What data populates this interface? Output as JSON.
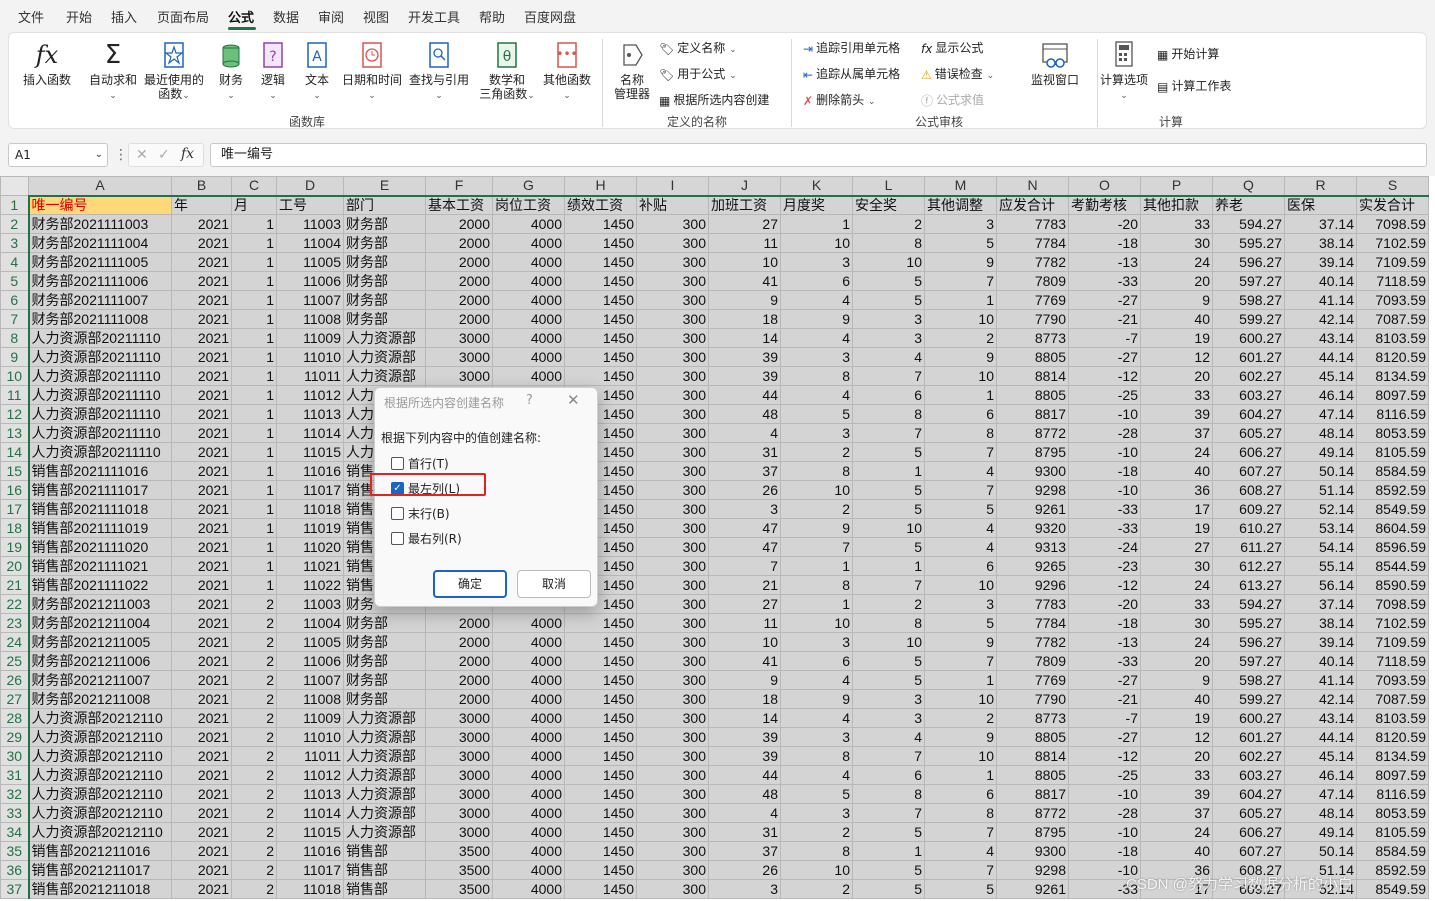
{
  "menu": [
    "文件",
    "开始",
    "插入",
    "页面布局",
    "公式",
    "数据",
    "审阅",
    "视图",
    "开发工具",
    "帮助",
    "百度网盘"
  ],
  "active_tab": "公式",
  "ribbon": {
    "insert_function": "插入函数",
    "autosum": "自动求和",
    "recent_1": "最近使用的",
    "recent_2": "函数",
    "financial": "财务",
    "logical": "逻辑",
    "text": "文本",
    "datetime": "日期和时间",
    "lookup": "查找与引用",
    "math_1": "数学和",
    "math_2": "三角函数",
    "more": "其他函数",
    "group_library": "函数库",
    "name_mgr_1": "名称",
    "name_mgr_2": "管理器",
    "define_name": "定义名称",
    "use_in_formula": "用于公式",
    "create_from_sel": "根据所选内容创建",
    "group_names": "定义的名称",
    "trace_precedents": "追踪引用单元格",
    "trace_dependents": "追踪从属单元格",
    "remove_arrows": "删除箭头",
    "show_formulas": "显示公式",
    "error_check": "错误检查",
    "evaluate": "公式求值",
    "watch": "监视窗口",
    "group_audit": "公式审核",
    "calc_options": "计算选项",
    "calc_now": "开始计算",
    "calc_sheet": "计算工作表",
    "group_calc": "计算"
  },
  "formula_bar": {
    "name_box": "A1",
    "fx": "fx",
    "content": "唯一编号"
  },
  "columns": [
    "A",
    "B",
    "C",
    "D",
    "E",
    "F",
    "G",
    "H",
    "I",
    "J",
    "K",
    "L",
    "M",
    "N",
    "O",
    "P",
    "Q",
    "R",
    "S"
  ],
  "header_row": [
    "唯一编号",
    "年",
    "月",
    "工号",
    "部门",
    "基本工资",
    "岗位工资",
    "绩效工资",
    "补贴",
    "加班工资",
    "月度奖",
    "安全奖",
    "其他调整",
    "应发合计",
    "考勤考核",
    "其他扣款",
    "养老",
    "医保",
    "实发合计"
  ],
  "rows": [
    [
      "财务部2021111003",
      "2021",
      "1",
      "11003",
      "财务部",
      "2000",
      "4000",
      "1450",
      "300",
      "27",
      "1",
      "2",
      "3",
      "7783",
      "-20",
      "33",
      "594.27",
      "37.14",
      "7098.59"
    ],
    [
      "财务部2021111004",
      "2021",
      "1",
      "11004",
      "财务部",
      "2000",
      "4000",
      "1450",
      "300",
      "11",
      "10",
      "8",
      "5",
      "7784",
      "-18",
      "30",
      "595.27",
      "38.14",
      "7102.59"
    ],
    [
      "财务部2021111005",
      "2021",
      "1",
      "11005",
      "财务部",
      "2000",
      "4000",
      "1450",
      "300",
      "10",
      "3",
      "10",
      "9",
      "7782",
      "-13",
      "24",
      "596.27",
      "39.14",
      "7109.59"
    ],
    [
      "财务部2021111006",
      "2021",
      "1",
      "11006",
      "财务部",
      "2000",
      "4000",
      "1450",
      "300",
      "41",
      "6",
      "5",
      "7",
      "7809",
      "-33",
      "20",
      "597.27",
      "40.14",
      "7118.59"
    ],
    [
      "财务部2021111007",
      "2021",
      "1",
      "11007",
      "财务部",
      "2000",
      "4000",
      "1450",
      "300",
      "9",
      "4",
      "5",
      "1",
      "7769",
      "-27",
      "9",
      "598.27",
      "41.14",
      "7093.59"
    ],
    [
      "财务部2021111008",
      "2021",
      "1",
      "11008",
      "财务部",
      "2000",
      "4000",
      "1450",
      "300",
      "18",
      "9",
      "3",
      "10",
      "7790",
      "-21",
      "40",
      "599.27",
      "42.14",
      "7087.59"
    ],
    [
      "人力资源部20211110",
      "2021",
      "1",
      "11009",
      "人力资源部",
      "3000",
      "4000",
      "1450",
      "300",
      "14",
      "4",
      "3",
      "2",
      "8773",
      "-7",
      "19",
      "600.27",
      "43.14",
      "8103.59"
    ],
    [
      "人力资源部20211110",
      "2021",
      "1",
      "11010",
      "人力资源部",
      "3000",
      "4000",
      "1450",
      "300",
      "39",
      "3",
      "4",
      "9",
      "8805",
      "-27",
      "12",
      "601.27",
      "44.14",
      "8120.59"
    ],
    [
      "人力资源部20211110",
      "2021",
      "1",
      "11011",
      "人力资源部",
      "3000",
      "4000",
      "1450",
      "300",
      "39",
      "8",
      "7",
      "10",
      "8814",
      "-12",
      "20",
      "602.27",
      "45.14",
      "8134.59"
    ],
    [
      "人力资源部20211110",
      "2021",
      "1",
      "11012",
      "人力",
      "",
      "",
      "1450",
      "300",
      "44",
      "4",
      "6",
      "1",
      "8805",
      "-25",
      "33",
      "603.27",
      "46.14",
      "8097.59"
    ],
    [
      "人力资源部20211110",
      "2021",
      "1",
      "11013",
      "人力",
      "",
      "",
      "1450",
      "300",
      "48",
      "5",
      "8",
      "6",
      "8817",
      "-10",
      "39",
      "604.27",
      "47.14",
      "8116.59"
    ],
    [
      "人力资源部20211110",
      "2021",
      "1",
      "11014",
      "人力",
      "",
      "",
      "1450",
      "300",
      "4",
      "3",
      "7",
      "8",
      "8772",
      "-28",
      "37",
      "605.27",
      "48.14",
      "8053.59"
    ],
    [
      "人力资源部20211110",
      "2021",
      "1",
      "11015",
      "人力",
      "",
      "",
      "1450",
      "300",
      "31",
      "2",
      "5",
      "7",
      "8795",
      "-10",
      "24",
      "606.27",
      "49.14",
      "8105.59"
    ],
    [
      "销售部2021111016",
      "2021",
      "1",
      "11016",
      "销售",
      "",
      "",
      "1450",
      "300",
      "37",
      "8",
      "1",
      "4",
      "9300",
      "-18",
      "40",
      "607.27",
      "50.14",
      "8584.59"
    ],
    [
      "销售部2021111017",
      "2021",
      "1",
      "11017",
      "销售",
      "",
      "",
      "1450",
      "300",
      "26",
      "10",
      "5",
      "7",
      "9298",
      "-10",
      "36",
      "608.27",
      "51.14",
      "8592.59"
    ],
    [
      "销售部2021111018",
      "2021",
      "1",
      "11018",
      "销售",
      "",
      "",
      "1450",
      "300",
      "3",
      "2",
      "5",
      "5",
      "9261",
      "-33",
      "17",
      "609.27",
      "52.14",
      "8549.59"
    ],
    [
      "销售部2021111019",
      "2021",
      "1",
      "11019",
      "销售",
      "",
      "",
      "1450",
      "300",
      "47",
      "9",
      "10",
      "4",
      "9320",
      "-33",
      "19",
      "610.27",
      "53.14",
      "8604.59"
    ],
    [
      "销售部2021111020",
      "2021",
      "1",
      "11020",
      "销售",
      "",
      "",
      "1450",
      "300",
      "47",
      "7",
      "5",
      "4",
      "9313",
      "-24",
      "27",
      "611.27",
      "54.14",
      "8596.59"
    ],
    [
      "销售部2021111021",
      "2021",
      "1",
      "11021",
      "销售",
      "",
      "",
      "1450",
      "300",
      "7",
      "1",
      "1",
      "6",
      "9265",
      "-23",
      "30",
      "612.27",
      "55.14",
      "8544.59"
    ],
    [
      "销售部2021111022",
      "2021",
      "1",
      "11022",
      "销售",
      "",
      "",
      "1450",
      "300",
      "21",
      "8",
      "7",
      "10",
      "9296",
      "-12",
      "24",
      "613.27",
      "56.14",
      "8590.59"
    ],
    [
      "财务部2021211003",
      "2021",
      "2",
      "11003",
      "财务",
      "",
      "",
      "1450",
      "300",
      "27",
      "1",
      "2",
      "3",
      "7783",
      "-20",
      "33",
      "594.27",
      "37.14",
      "7098.59"
    ],
    [
      "财务部2021211004",
      "2021",
      "2",
      "11004",
      "财务部",
      "2000",
      "4000",
      "1450",
      "300",
      "11",
      "10",
      "8",
      "5",
      "7784",
      "-18",
      "30",
      "595.27",
      "38.14",
      "7102.59"
    ],
    [
      "财务部2021211005",
      "2021",
      "2",
      "11005",
      "财务部",
      "2000",
      "4000",
      "1450",
      "300",
      "10",
      "3",
      "10",
      "9",
      "7782",
      "-13",
      "24",
      "596.27",
      "39.14",
      "7109.59"
    ],
    [
      "财务部2021211006",
      "2021",
      "2",
      "11006",
      "财务部",
      "2000",
      "4000",
      "1450",
      "300",
      "41",
      "6",
      "5",
      "7",
      "7809",
      "-33",
      "20",
      "597.27",
      "40.14",
      "7118.59"
    ],
    [
      "财务部2021211007",
      "2021",
      "2",
      "11007",
      "财务部",
      "2000",
      "4000",
      "1450",
      "300",
      "9",
      "4",
      "5",
      "1",
      "7769",
      "-27",
      "9",
      "598.27",
      "41.14",
      "7093.59"
    ],
    [
      "财务部2021211008",
      "2021",
      "2",
      "11008",
      "财务部",
      "2000",
      "4000",
      "1450",
      "300",
      "18",
      "9",
      "3",
      "10",
      "7790",
      "-21",
      "40",
      "599.27",
      "42.14",
      "7087.59"
    ],
    [
      "人力资源部20212110",
      "2021",
      "2",
      "11009",
      "人力资源部",
      "3000",
      "4000",
      "1450",
      "300",
      "14",
      "4",
      "3",
      "2",
      "8773",
      "-7",
      "19",
      "600.27",
      "43.14",
      "8103.59"
    ],
    [
      "人力资源部20212110",
      "2021",
      "2",
      "11010",
      "人力资源部",
      "3000",
      "4000",
      "1450",
      "300",
      "39",
      "3",
      "4",
      "9",
      "8805",
      "-27",
      "12",
      "601.27",
      "44.14",
      "8120.59"
    ],
    [
      "人力资源部20212110",
      "2021",
      "2",
      "11011",
      "人力资源部",
      "3000",
      "4000",
      "1450",
      "300",
      "39",
      "8",
      "7",
      "10",
      "8814",
      "-12",
      "20",
      "602.27",
      "45.14",
      "8134.59"
    ],
    [
      "人力资源部20212110",
      "2021",
      "2",
      "11012",
      "人力资源部",
      "3000",
      "4000",
      "1450",
      "300",
      "44",
      "4",
      "6",
      "1",
      "8805",
      "-25",
      "33",
      "603.27",
      "46.14",
      "8097.59"
    ],
    [
      "人力资源部20212110",
      "2021",
      "2",
      "11013",
      "人力资源部",
      "3000",
      "4000",
      "1450",
      "300",
      "48",
      "5",
      "8",
      "6",
      "8817",
      "-10",
      "39",
      "604.27",
      "47.14",
      "8116.59"
    ],
    [
      "人力资源部20212110",
      "2021",
      "2",
      "11014",
      "人力资源部",
      "3000",
      "4000",
      "1450",
      "300",
      "4",
      "3",
      "7",
      "8",
      "8772",
      "-28",
      "37",
      "605.27",
      "48.14",
      "8053.59"
    ],
    [
      "人力资源部20212110",
      "2021",
      "2",
      "11015",
      "人力资源部",
      "3000",
      "4000",
      "1450",
      "300",
      "31",
      "2",
      "5",
      "7",
      "8795",
      "-10",
      "24",
      "606.27",
      "49.14",
      "8105.59"
    ],
    [
      "销售部2021211016",
      "2021",
      "2",
      "11016",
      "销售部",
      "3500",
      "4000",
      "1450",
      "300",
      "37",
      "8",
      "1",
      "4",
      "9300",
      "-18",
      "40",
      "607.27",
      "50.14",
      "8584.59"
    ],
    [
      "销售部2021211017",
      "2021",
      "2",
      "11017",
      "销售部",
      "3500",
      "4000",
      "1450",
      "300",
      "26",
      "10",
      "5",
      "7",
      "9298",
      "-10",
      "36",
      "608.27",
      "51.14",
      "8592.59"
    ],
    [
      "销售部2021211018",
      "2021",
      "2",
      "11018",
      "销售部",
      "3500",
      "4000",
      "1450",
      "300",
      "3",
      "2",
      "5",
      "5",
      "9261",
      "-33",
      "17",
      "609.27",
      "52.14",
      "8549.59"
    ]
  ],
  "dialog": {
    "title": "根据所选内容创建名称",
    "help": "?",
    "close": "✕",
    "prompt": "根据下列内容中的值创建名称:",
    "options": [
      {
        "label": "首行(T)",
        "checked": false
      },
      {
        "label": "最左列(L)",
        "checked": true
      },
      {
        "label": "末行(B)",
        "checked": false
      },
      {
        "label": "最右列(R)",
        "checked": false
      }
    ],
    "ok": "确定",
    "cancel": "取消"
  },
  "watermark": "CSDN @努力学习数据分析的小白",
  "colors": {
    "accent": "#217346",
    "checkbox": "#1a64c4",
    "highlight_box": "#e0241f",
    "a1_fill": "#ffd87a",
    "a1_text": "#e00000"
  }
}
